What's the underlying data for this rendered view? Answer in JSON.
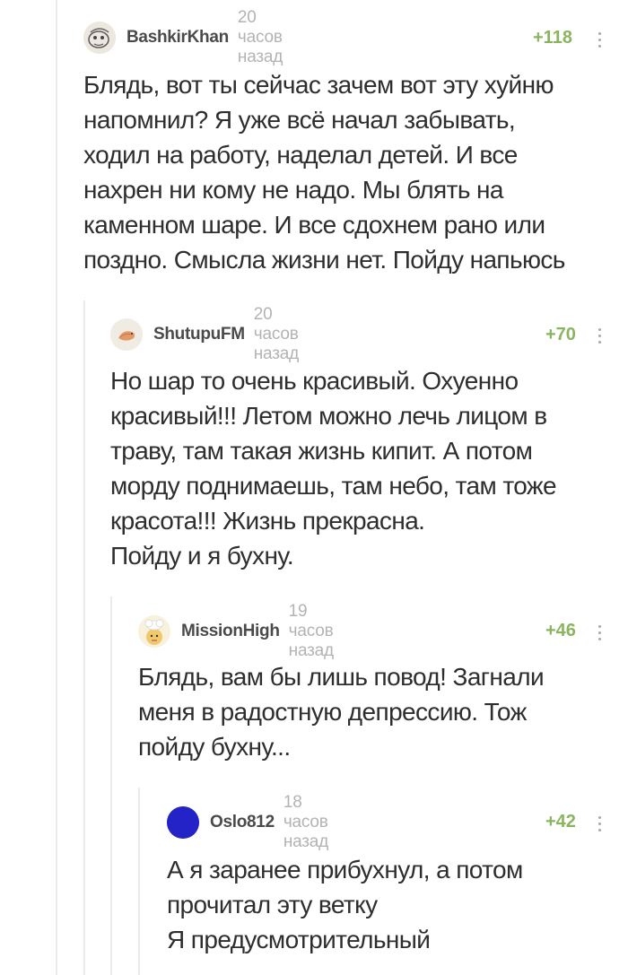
{
  "comments": [
    {
      "username": "BashkirKhan",
      "time": "20 часов назад",
      "rating": "+118",
      "lines": [
        "Блядь, вот ты сейчас зачем вот эту хуйню",
        "напомнил? Я уже всё начал забывать,",
        "ходил на работу, наделал детей. И все",
        "нахрен ни кому не надо. Мы блять на",
        "каменном шаре. И все сдохнем рано или",
        "поздно. Смысла жизни нет. Пойду напьюсь"
      ]
    },
    {
      "username": "ShutupuFM",
      "time": "20 часов назад",
      "rating": "+70",
      "lines": [
        "Но шар то очень красивый. Охуенно",
        "красивый!!! Летом можно лечь лицом в",
        "траву, там такая жизнь кипит. А потом",
        "морду поднимаешь, там небо, там тоже",
        "красота!!!  Жизнь прекрасна.",
        "Пойду и я бухну."
      ]
    },
    {
      "username": "MissionHigh",
      "time": "19 часов назад",
      "rating": "+46",
      "lines": [
        "Блядь, вам бы лишь повод! Загнали",
        "меня в радостную депрессию. Тож",
        "пойду бухну..."
      ]
    },
    {
      "username": "Oslo812",
      "time": "18 часов назад",
      "rating": "+42",
      "lines": [
        "А я заранее прибухнул, а потом",
        "прочитал эту ветку",
        "Я предусмотрительный"
      ]
    }
  ],
  "colors": {
    "rating": "#8ab55f",
    "username": "#4a4a4a",
    "time": "#b3b3b3",
    "thread_line": "#e9ecef",
    "oslo_avatar": "#2323c8"
  }
}
